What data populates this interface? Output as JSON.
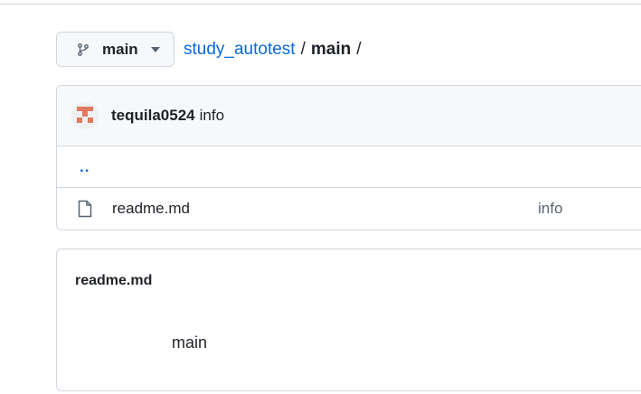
{
  "branch": {
    "name": "main"
  },
  "breadcrumb": {
    "repo": "study_autotest",
    "separator": "/",
    "path": "main",
    "trailing": "/"
  },
  "commit": {
    "author": "tequila0524",
    "message": "info"
  },
  "files": {
    "parent_link": "..",
    "rows": [
      {
        "name": "readme.md",
        "commit_message": "info"
      }
    ]
  },
  "readme": {
    "title": "readme.md",
    "content": "main"
  },
  "icons": {
    "branch": "git-branch-icon",
    "caret": "triangle-down-icon",
    "file": "file-icon",
    "avatar": "identicon-avatar"
  },
  "colors": {
    "link": "#0969da",
    "border": "#d0d7de",
    "header_bg": "#f6f8fa",
    "avatar_accent": "#e07a5f"
  }
}
